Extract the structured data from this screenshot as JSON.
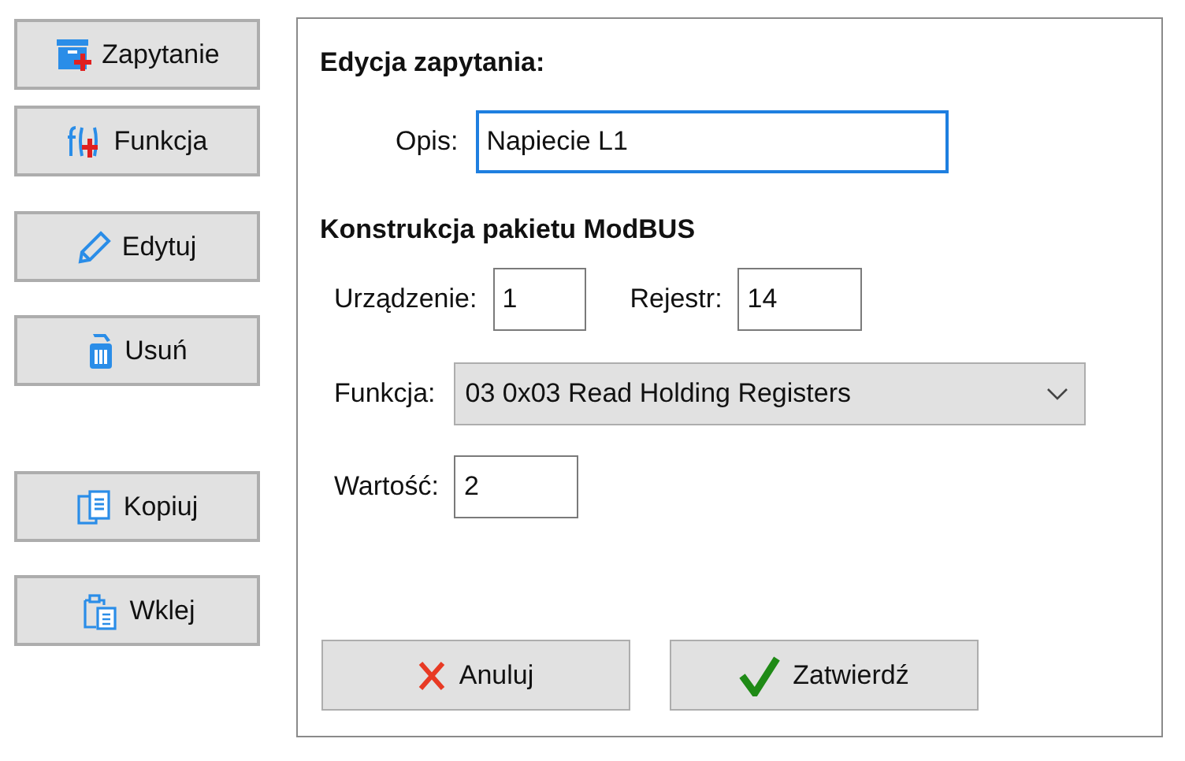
{
  "toolbar": [
    {
      "label": "Zapytanie",
      "kind": "query"
    },
    {
      "label": "Funkcja",
      "kind": "function"
    },
    {
      "label": "Edytuj",
      "kind": "edit"
    },
    {
      "label": "Usuń",
      "kind": "delete"
    },
    {
      "label": "Kopiuj",
      "kind": "copy"
    },
    {
      "label": "Wklej",
      "kind": "paste"
    }
  ],
  "panel": {
    "title": "Edycja zapytania:",
    "description": {
      "label": "Opis:",
      "value": "Napiecie L1"
    },
    "section_title": "Konstrukcja pakietu ModBUS",
    "device": {
      "label": "Urządzenie:",
      "value": "1"
    },
    "register": {
      "label": "Rejestr:",
      "value": "14"
    },
    "function": {
      "label": "Funkcja:",
      "value": "03 0x03 Read Holding Registers"
    },
    "value": {
      "label": "Wartość:",
      "value": "2"
    },
    "buttons": [
      {
        "label": "Anuluj",
        "kind": "cancel"
      },
      {
        "label": "Zatwierdź",
        "kind": "confirm"
      }
    ]
  }
}
